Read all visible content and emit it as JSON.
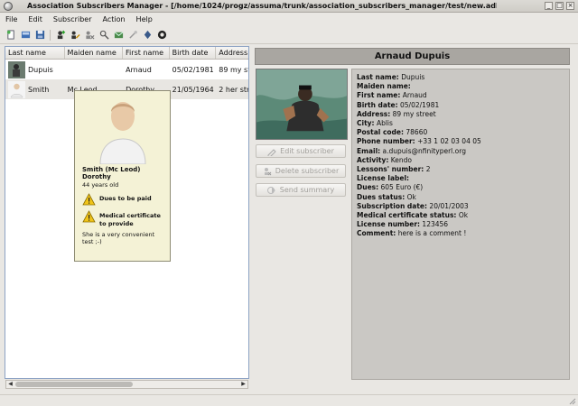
{
  "window": {
    "title": "Association Subscribers Manager - [/home/1024/progz/assuma/trunk/association_subscribers_manager/test/new.adb]"
  },
  "menu": {
    "items": [
      "File",
      "Edit",
      "Subscriber",
      "Action",
      "Help"
    ]
  },
  "toolbar": {
    "icons": [
      "new-file-icon",
      "open-icon",
      "save-icon",
      "add-subscriber-icon",
      "edit-icon",
      "delete-icon",
      "search-icon",
      "send-icon",
      "tools-icon",
      "about-icon",
      "help-icon"
    ]
  },
  "list": {
    "columns": [
      "Last name",
      "Maiden name",
      "First name",
      "Birth date",
      "Address"
    ],
    "rows": [
      {
        "last_name": "Dupuis",
        "maiden_name": "",
        "first_name": "Arnaud",
        "birth_date": "05/02/1981",
        "address": "89 my str"
      },
      {
        "last_name": "Smith",
        "maiden_name": "Mc Leod",
        "first_name": "Dorothy",
        "birth_date": "21/05/1964",
        "address": "2 her stre"
      }
    ]
  },
  "tooltip": {
    "name_line": "Smith (Mc Leod)",
    "first_name": "Dorothy",
    "age": "44 years old",
    "warnings": [
      "Dues to be paid",
      "Medical certificate to provide"
    ],
    "comment": "She is a very convenient test ;-)"
  },
  "detail": {
    "header": "Arnaud Dupuis",
    "buttons": {
      "edit": "Edit subscriber",
      "delete": "Delete subscriber",
      "send": "Send summary"
    },
    "fields": [
      {
        "label": "Last name:",
        "value": "Dupuis"
      },
      {
        "label": "Maiden name:",
        "value": ""
      },
      {
        "label": "First name:",
        "value": "Arnaud"
      },
      {
        "label": "Birth date:",
        "value": "05/02/1981"
      },
      {
        "label": "Address:",
        "value": "89 my street"
      },
      {
        "label": "City:",
        "value": "Ablis"
      },
      {
        "label": "Postal code:",
        "value": "78660"
      },
      {
        "label": "Phone number:",
        "value": "+33 1 02 03 04 05"
      },
      {
        "label": "Email:",
        "value": "a.dupuis@nfinityperl.org"
      },
      {
        "label": "Activity:",
        "value": "Kendo"
      },
      {
        "label": "Lessons' number:",
        "value": "2"
      },
      {
        "label": "License label:",
        "value": ""
      },
      {
        "label": "Dues:",
        "value": "605 Euro (€)"
      },
      {
        "label": "Dues status:",
        "value": "Ok"
      },
      {
        "label": "Subscription date:",
        "value": "20/01/2003"
      },
      {
        "label": "Medical certificate status:",
        "value": "Ok"
      },
      {
        "label": "License number:",
        "value": "123456"
      },
      {
        "label": "Comment:",
        "value": "here is a comment !"
      }
    ]
  },
  "colors": {
    "accent": "#8da3c4",
    "header_bg": "#a9a6a1",
    "info_bg": "#cac8c4",
    "tooltip_bg": "#f4f2d6",
    "warning": "#f0c419"
  }
}
